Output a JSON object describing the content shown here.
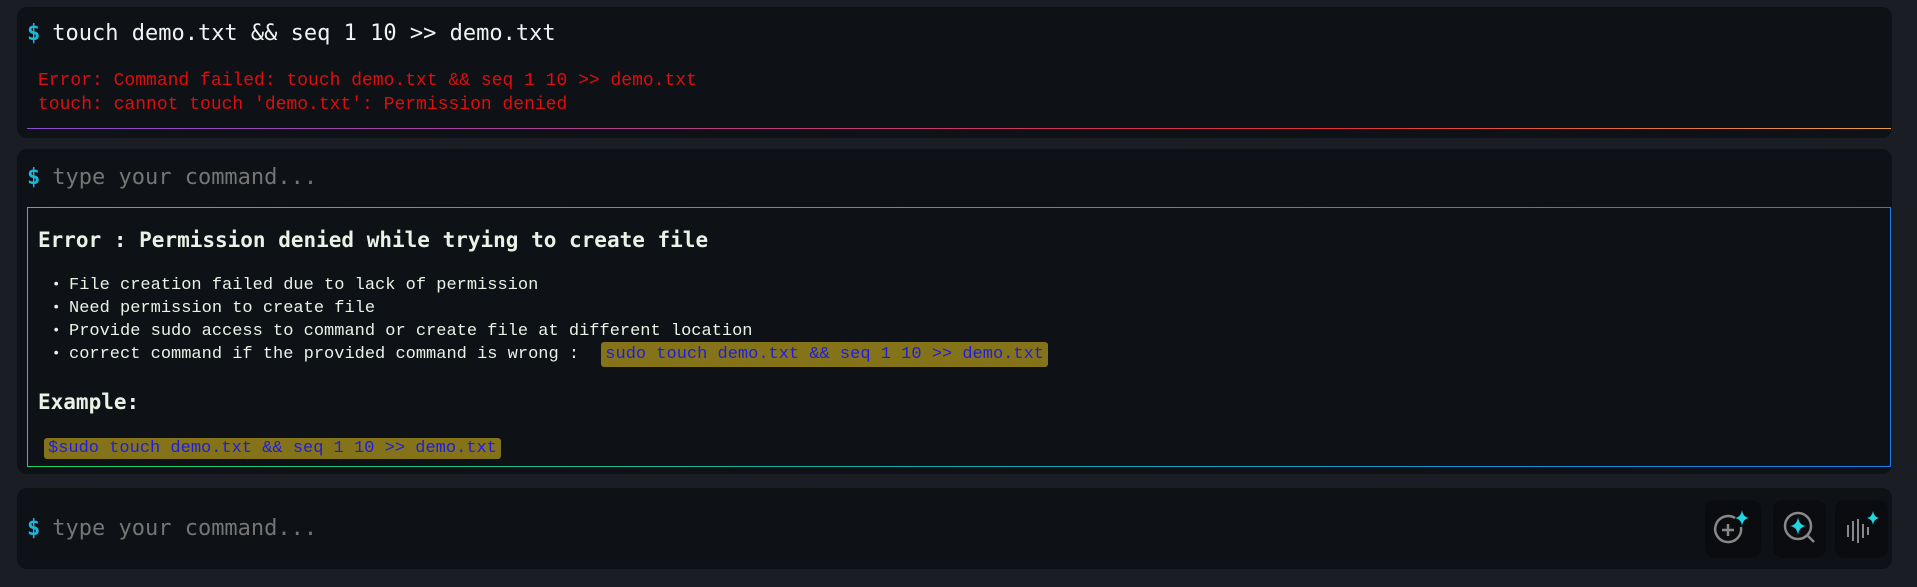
{
  "history": {
    "command": "touch demo.txt && seq 1 10 >> demo.txt",
    "output": [
      "Error: Command failed: touch demo.txt && seq 1 10 >> demo.txt",
      "touch: cannot touch 'demo.txt': Permission denied"
    ]
  },
  "prompt_symbol": "$",
  "assistant": {
    "input_placeholder": "type your command...",
    "heading": "Error : Permission denied while trying to create file",
    "bullets": [
      "File creation failed due to lack of permission",
      "Need permission to create file",
      "Provide sudo access to command or create file at different location",
      "correct command if the provided command is wrong : "
    ],
    "suggested_command": "sudo touch demo.txt && seq 1 10 >> demo.txt",
    "example_heading": "Example:",
    "example_command": "$sudo touch demo.txt && seq 1 10 >> demo.txt"
  },
  "bottom": {
    "input_placeholder": "type your command...",
    "buttons": [
      {
        "icon": "ai-add-icon"
      },
      {
        "icon": "ai-search-icon"
      },
      {
        "icon": "ai-voice-icon"
      }
    ]
  },
  "colors": {
    "accent": "#1fb5d8",
    "error": "#e00d0d",
    "sparkle": "#22d3e0",
    "code_bg": "#847318",
    "code_fg": "#1d1de6"
  }
}
